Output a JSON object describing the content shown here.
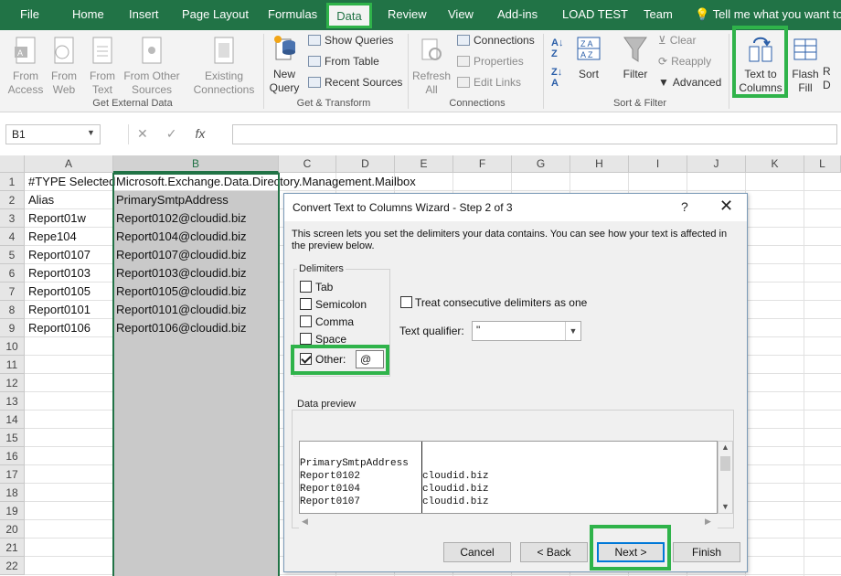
{
  "tabs": [
    "File",
    "Home",
    "Insert",
    "Page Layout",
    "Formulas",
    "Data",
    "Review",
    "View",
    "Add-ins",
    "LOAD TEST",
    "Team"
  ],
  "tell_me": "Tell me what you want to",
  "ribbon": {
    "get_external": {
      "from_access": "From\nAccess",
      "from_web": "From\nWeb",
      "from_text": "From\nText",
      "from_other": "From Other\nSources",
      "existing": "Existing\nConnections",
      "label": "Get External Data"
    },
    "get_transform": {
      "new_query": "New\nQuery",
      "show_queries": "Show Queries",
      "from_table": "From Table",
      "recent_sources": "Recent Sources",
      "label": "Get & Transform"
    },
    "connections": {
      "refresh_all": "Refresh\nAll",
      "connections": "Connections",
      "properties": "Properties",
      "edit_links": "Edit Links",
      "label": "Connections"
    },
    "sort_filter": {
      "sort": "Sort",
      "filter": "Filter",
      "clear": "Clear",
      "reapply": "Reapply",
      "advanced": "Advanced",
      "label": "Sort & Filter"
    },
    "data_tools": {
      "text_to_columns": "Text to\nColumns",
      "flash_fill": "Flash\nFill",
      "rem": "R\nD"
    }
  },
  "name_box": "B1",
  "columns": [
    "A",
    "B",
    "C",
    "D",
    "E",
    "F",
    "G",
    "H",
    "I",
    "J",
    "K",
    "L"
  ],
  "rows": [
    "1",
    "2",
    "3",
    "4",
    "5",
    "6",
    "7",
    "8",
    "9",
    "10",
    "11",
    "12",
    "13",
    "14",
    "15",
    "16",
    "17",
    "18",
    "19",
    "20",
    "21",
    "22"
  ],
  "cells": {
    "a1": "#TYPE Selected",
    "b1": "Microsoft.Exchange.Data.Directory.Management.Mailbox",
    "col_a": [
      "Alias",
      "Report01w",
      "Repe104",
      "Report0107",
      "Report0103",
      "Report0105",
      "Report0101",
      "Report0106"
    ],
    "col_b": [
      "PrimarySmtpAddress",
      "Report0102@cloudid.biz",
      "Report0104@cloudid.biz",
      "Report0107@cloudid.biz",
      "Report0103@cloudid.biz",
      "Report0105@cloudid.biz",
      "Report0101@cloudid.biz",
      "Report0106@cloudid.biz"
    ]
  },
  "dialog": {
    "title": "Convert Text to Columns Wizard - Step 2 of 3",
    "help": "?",
    "close": "✕",
    "description": "This screen lets you set the delimiters your data contains.  You can see how your text is affected in the preview below.",
    "delimiters_label": "Delimiters",
    "tab": "Tab",
    "semicolon": "Semicolon",
    "comma": "Comma",
    "space": "Space",
    "other": "Other:",
    "other_value": "@",
    "consecutive": "Treat consecutive delimiters as one",
    "qualifier_label": "Text qualifier:",
    "qualifier_value": "\"",
    "preview_label": "Data preview",
    "preview_col1": [
      "PrimarySmtpAddress",
      "Report0102",
      "Report0104",
      "Report0107"
    ],
    "preview_col2": [
      "",
      "cloudid.biz",
      "cloudid.biz",
      "cloudid.biz"
    ],
    "cancel": "Cancel",
    "back": "< Back",
    "next": "Next >",
    "finish": "Finish"
  },
  "colors": {
    "accent": "#217346",
    "highlight": "#2fb34a"
  }
}
